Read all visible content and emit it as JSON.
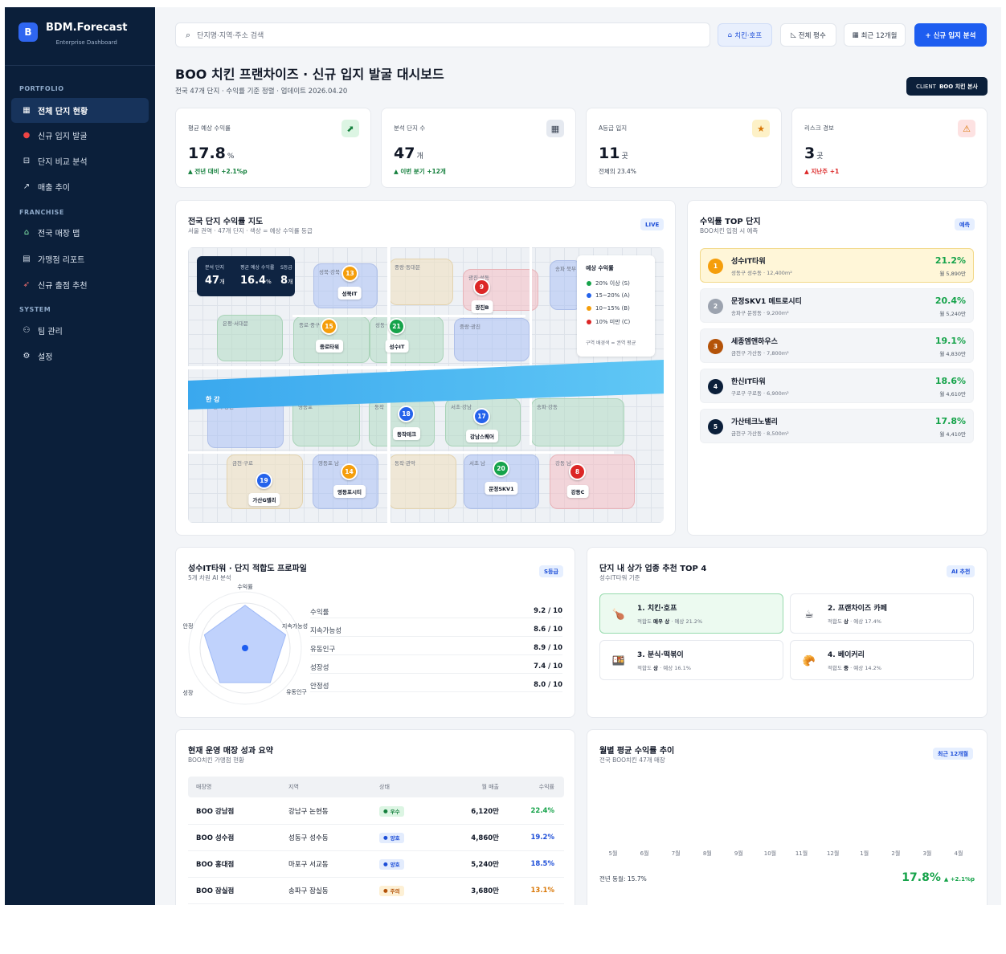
{
  "sidebar": {
    "logo_letter": "B",
    "brand": "BDM.Forecast",
    "brand_sub": "Enterprise Dashboard",
    "sections": {
      "portfolio": "PORTFOLIO",
      "franchise": "FRANCHISE",
      "system": "SYSTEM"
    },
    "items": [
      {
        "label": "전체 단지 현황",
        "icon": "building-icon"
      },
      {
        "label": "신규 입지 발굴",
        "icon": "pin-icon"
      },
      {
        "label": "단지 비교 분석",
        "icon": "compare-icon"
      },
      {
        "label": "매출 추이",
        "icon": "chart-icon"
      },
      {
        "label": "전국 매장 맵",
        "icon": "store-map-icon"
      },
      {
        "label": "가맹점 리포트",
        "icon": "report-icon"
      },
      {
        "label": "신규 출점 추천",
        "icon": "recommend-icon"
      },
      {
        "label": "팀 관리",
        "icon": "team-icon"
      },
      {
        "label": "설정",
        "icon": "gear-icon"
      }
    ]
  },
  "header": {
    "search_placeholder": "단지명·지역·주소 검색",
    "filter_category": "치킨·호프",
    "filter_area": "전체 평수",
    "filter_period": "최근 12개월",
    "new_button": "+ 신규 입지 분석",
    "title": "BOO 치킨 프랜차이즈 · 신규 입지 발굴 대시보드",
    "subtitle": "전국 47개 단지 · 수익률 기준 정렬 · 업데이트 2026.04.20",
    "client_label": "CLIENT",
    "client_name": "BOO 치킨 본사"
  },
  "kpis": [
    {
      "label": "평균 예상 수익률",
      "value": "17.8",
      "unit": "%",
      "delta": "▲ 전년 대비 +2.1%p",
      "icon": "trend-icon"
    },
    {
      "label": "분석 단지 수",
      "value": "47",
      "unit": "개",
      "delta": "▲ 이번 분기 +12개",
      "icon": "building-icon"
    },
    {
      "label": "A등급 입지",
      "value": "11",
      "unit": "곳",
      "delta": "전체의 23.4%",
      "icon": "star-icon"
    },
    {
      "label": "리스크 경보",
      "value": "3",
      "unit": "곳",
      "delta": "▲ 지난주 +1",
      "icon": "warning-icon"
    }
  ],
  "map": {
    "title": "전국 단지 수익률 지도",
    "subtitle": "서울 권역 · 47개 단지 · 색상 = 예상 수익률 등급",
    "badge": "LIVE",
    "stats": [
      {
        "label": "분석 단지",
        "value": "47",
        "unit": "개"
      },
      {
        "label": "평균 예상 수익률",
        "value": "16.4",
        "unit": "%"
      },
      {
        "label": "S등급",
        "value": "8",
        "unit": "개"
      }
    ],
    "river": "한 강",
    "zones": [
      "성북·강북",
      "중랑·동대문",
      "광진·성동",
      "송파 북부",
      "은평·서대문",
      "종로·중구",
      "성동·광진",
      "중랑·광진",
      "강서·양천",
      "영등포",
      "동작",
      "서초·강남",
      "송파·강동",
      "금천·구로",
      "영등포 남",
      "동작·관악",
      "서초 남",
      "강동 남"
    ],
    "pins": [
      {
        "num": "13",
        "label": "성북IT"
      },
      {
        "num": "9",
        "label": "광진B"
      },
      {
        "num": "15",
        "label": "종로타워"
      },
      {
        "num": "21",
        "label": "성수IT"
      },
      {
        "num": "18",
        "label": "동작테크"
      },
      {
        "num": "17",
        "label": "강남스퀘어"
      },
      {
        "num": "19",
        "label": "가산G밸리"
      },
      {
        "num": "14",
        "label": "영등포시티"
      },
      {
        "num": "20",
        "label": "문정SKV1"
      },
      {
        "num": "8",
        "label": "강동C"
      }
    ],
    "legend_title": "예상 수익률",
    "legend": [
      {
        "label": "20% 이상 (S)",
        "color": "#16a34a"
      },
      {
        "label": "15~20% (A)",
        "color": "#2563eb"
      },
      {
        "label": "10~15% (B)",
        "color": "#f59e0b"
      },
      {
        "label": "10% 미만 (C)",
        "color": "#dc2626"
      }
    ],
    "legend_foot": "구역 배경색 = 권역 평균"
  },
  "top": {
    "title": "수익률 TOP 단지",
    "subtitle": "BOO치킨 입점 시 예측",
    "badge": "예측",
    "items": [
      {
        "rank": "1",
        "name": "성수IT타워",
        "sub": "성동구 성수동 · 12,400m²",
        "pct": "21.2%",
        "monthly": "월 5,890만"
      },
      {
        "rank": "2",
        "name": "문정SKV1 메트로시티",
        "sub": "송파구 문정동 · 9,200m²",
        "pct": "20.4%",
        "monthly": "월 5,240만"
      },
      {
        "rank": "3",
        "name": "세종엠앤하우스",
        "sub": "금천구 가산동 · 7,800m²",
        "pct": "19.1%",
        "monthly": "월 4,830만"
      },
      {
        "rank": "4",
        "name": "한신IT타워",
        "sub": "구로구 구로동 · 6,900m²",
        "pct": "18.6%",
        "monthly": "월 4,610만"
      },
      {
        "rank": "5",
        "name": "가산테크노밸리",
        "sub": "금천구 가산동 · 8,500m²",
        "pct": "17.8%",
        "monthly": "월 4,410만"
      }
    ]
  },
  "radar": {
    "title": "성수IT타워 · 단지 적합도 프로파일",
    "subtitle": "5개 차원 AI 분석",
    "badge": "S등급",
    "axes": [
      "수익률",
      "지속가능성",
      "유동인구",
      "성장",
      "안정"
    ],
    "rows": [
      {
        "label": "수익률",
        "score": "9.2 / 10",
        "value": 9.2
      },
      {
        "label": "지속가능성",
        "score": "8.6 / 10",
        "value": 8.6
      },
      {
        "label": "유동인구",
        "score": "8.9 / 10",
        "value": 8.9
      },
      {
        "label": "성장성",
        "score": "7.4 / 10",
        "value": 7.4
      },
      {
        "label": "안정성",
        "score": "8.0 / 10",
        "value": 8.0
      }
    ]
  },
  "recommend": {
    "title": "단지 내 상가 업종 추천 TOP 4",
    "subtitle": "성수IT타워 기준",
    "badge": "AI 추천",
    "items": [
      {
        "name": "1. 치킨·호프",
        "fit_prefix": "적합도",
        "fit": "매우 상",
        "expected": "· 예상 21.2%",
        "icon": "chicken-icon",
        "glyph": "🍗"
      },
      {
        "name": "2. 프랜차이즈 카페",
        "fit_prefix": "적합도",
        "fit": "상",
        "expected": "· 예상 17.4%",
        "icon": "coffee-icon",
        "glyph": "☕"
      },
      {
        "name": "3. 분식·떡볶이",
        "fit_prefix": "적합도",
        "fit": "상",
        "expected": "· 예상 16.1%",
        "icon": "bento-icon",
        "glyph": "🍱"
      },
      {
        "name": "4. 베이커리",
        "fit_prefix": "적합도",
        "fit": "중",
        "expected": "· 예상 14.2%",
        "icon": "bread-icon",
        "glyph": "🥐"
      }
    ]
  },
  "stores": {
    "title": "현재 운영 매장 성과 요약",
    "subtitle": "BOO치킨 가맹점 현황",
    "columns": [
      "매장명",
      "지역",
      "상태",
      "월 매출",
      "수익률"
    ],
    "rows": [
      {
        "name": "BOO 강남점",
        "region": "강남구 논현동",
        "status": "우수",
        "sales": "6,120만",
        "rate": "22.4%"
      },
      {
        "name": "BOO 성수점",
        "region": "성동구 성수동",
        "status": "양호",
        "sales": "4,860만",
        "rate": "19.2%"
      },
      {
        "name": "BOO 홍대점",
        "region": "마포구 서교동",
        "status": "양호",
        "sales": "5,240만",
        "rate": "18.5%"
      },
      {
        "name": "BOO 잠실점",
        "region": "송파구 잠실동",
        "status": "주의",
        "sales": "3,680만",
        "rate": "13.1%"
      }
    ]
  },
  "trend": {
    "title": "월별 평균 수익률 추이",
    "subtitle": "전국 BOO치킨 47개 매장",
    "badge": "최근 12개월",
    "months": [
      "5월",
      "6월",
      "7월",
      "8월",
      "9월",
      "10월",
      "11월",
      "12월",
      "1월",
      "2월",
      "3월",
      "4월"
    ],
    "prev": "전년 동월: 15.7%",
    "current": "17.8%",
    "delta": "▲ +2.1%p"
  }
}
